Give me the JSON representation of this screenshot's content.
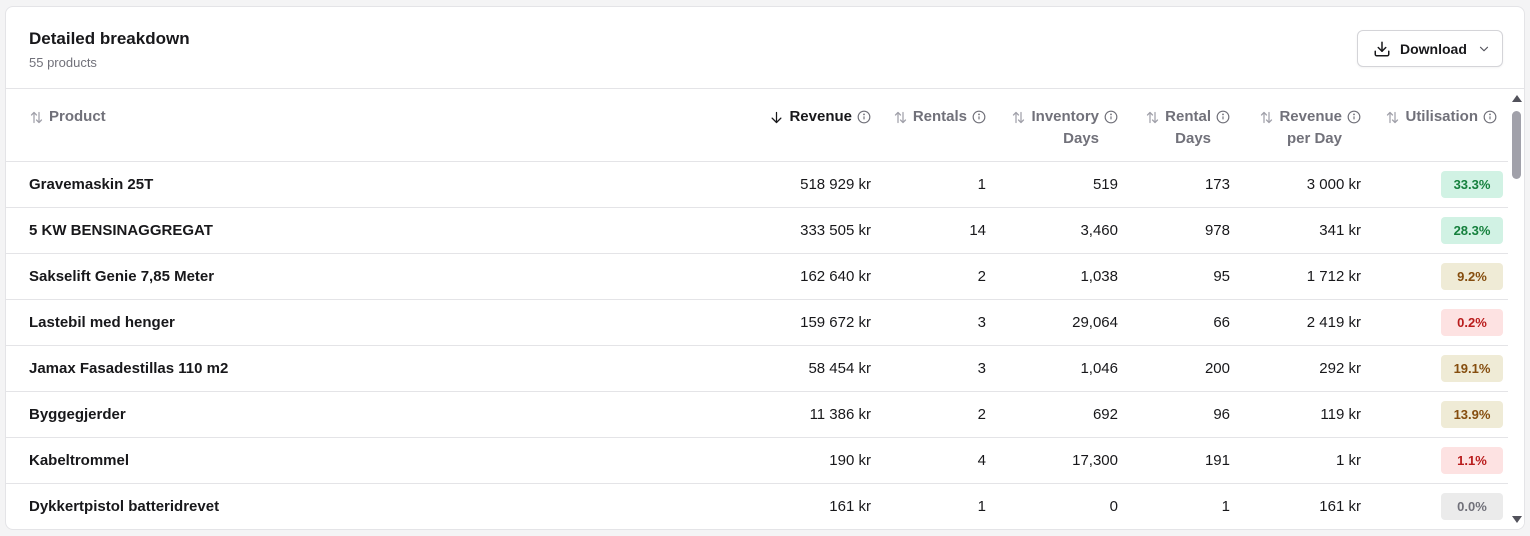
{
  "header": {
    "title": "Detailed breakdown",
    "subtitle": "55 products",
    "download_label": "Download"
  },
  "columns": [
    {
      "key": "product",
      "label": "Product",
      "active": false
    },
    {
      "key": "revenue",
      "label": "Revenue",
      "active": true
    },
    {
      "key": "rentals",
      "label": "Rentals",
      "active": false
    },
    {
      "key": "inventory_days",
      "label": "Inventory\nDays",
      "active": false
    },
    {
      "key": "rental_days",
      "label": "Rental\nDays",
      "active": false
    },
    {
      "key": "revenue_per_day",
      "label": "Revenue\nper Day",
      "active": false
    },
    {
      "key": "utilisation",
      "label": "Utilisation",
      "active": false
    }
  ],
  "rows": [
    {
      "product": "Gravemaskin 25T",
      "revenue": "518 929 kr",
      "rentals": "1",
      "inventory_days": "519",
      "rental_days": "173",
      "revenue_per_day": "3 000 kr",
      "utilisation": "33.3%",
      "util_level": "high"
    },
    {
      "product": "5 KW BENSINAGGREGAT",
      "revenue": "333 505 kr",
      "rentals": "14",
      "inventory_days": "3,460",
      "rental_days": "978",
      "revenue_per_day": "341 kr",
      "utilisation": "28.3%",
      "util_level": "high"
    },
    {
      "product": "Sakselift Genie 7,85 Meter",
      "revenue": "162 640 kr",
      "rentals": "2",
      "inventory_days": "1,038",
      "rental_days": "95",
      "revenue_per_day": "1 712 kr",
      "utilisation": "9.2%",
      "util_level": "mid"
    },
    {
      "product": "Lastebil med henger",
      "revenue": "159 672 kr",
      "rentals": "3",
      "inventory_days": "29,064",
      "rental_days": "66",
      "revenue_per_day": "2 419 kr",
      "utilisation": "0.2%",
      "util_level": "low"
    },
    {
      "product": "Jamax Fasadestillas 110 m2",
      "revenue": "58 454 kr",
      "rentals": "3",
      "inventory_days": "1,046",
      "rental_days": "200",
      "revenue_per_day": "292 kr",
      "utilisation": "19.1%",
      "util_level": "mid"
    },
    {
      "product": "Byggegjerder",
      "revenue": "11 386 kr",
      "rentals": "2",
      "inventory_days": "692",
      "rental_days": "96",
      "revenue_per_day": "119 kr",
      "utilisation": "13.9%",
      "util_level": "mid"
    },
    {
      "product": "Kabeltrommel",
      "revenue": "190 kr",
      "rentals": "4",
      "inventory_days": "17,300",
      "rental_days": "191",
      "revenue_per_day": "1 kr",
      "utilisation": "1.1%",
      "util_level": "low"
    },
    {
      "product": "Dykkertpistol batteridrevet",
      "revenue": "161 kr",
      "rentals": "1",
      "inventory_days": "0",
      "rental_days": "1",
      "revenue_per_day": "161 kr",
      "utilisation": "0.0%",
      "util_level": "none"
    }
  ],
  "colors": {
    "high_bg": "#d1f2e4",
    "high_fg": "#15803d",
    "mid_bg": "#efebd6",
    "mid_fg": "#854d0e",
    "low_bg": "#fde2e2",
    "low_fg": "#b91c1c",
    "none_bg": "#ebebeb",
    "none_fg": "#71717a"
  },
  "icons": {
    "download": "download-icon",
    "chevron": "chevron-down-icon",
    "sort": "sort-icon",
    "sort_active": "arrow-down-icon",
    "info": "info-icon"
  }
}
